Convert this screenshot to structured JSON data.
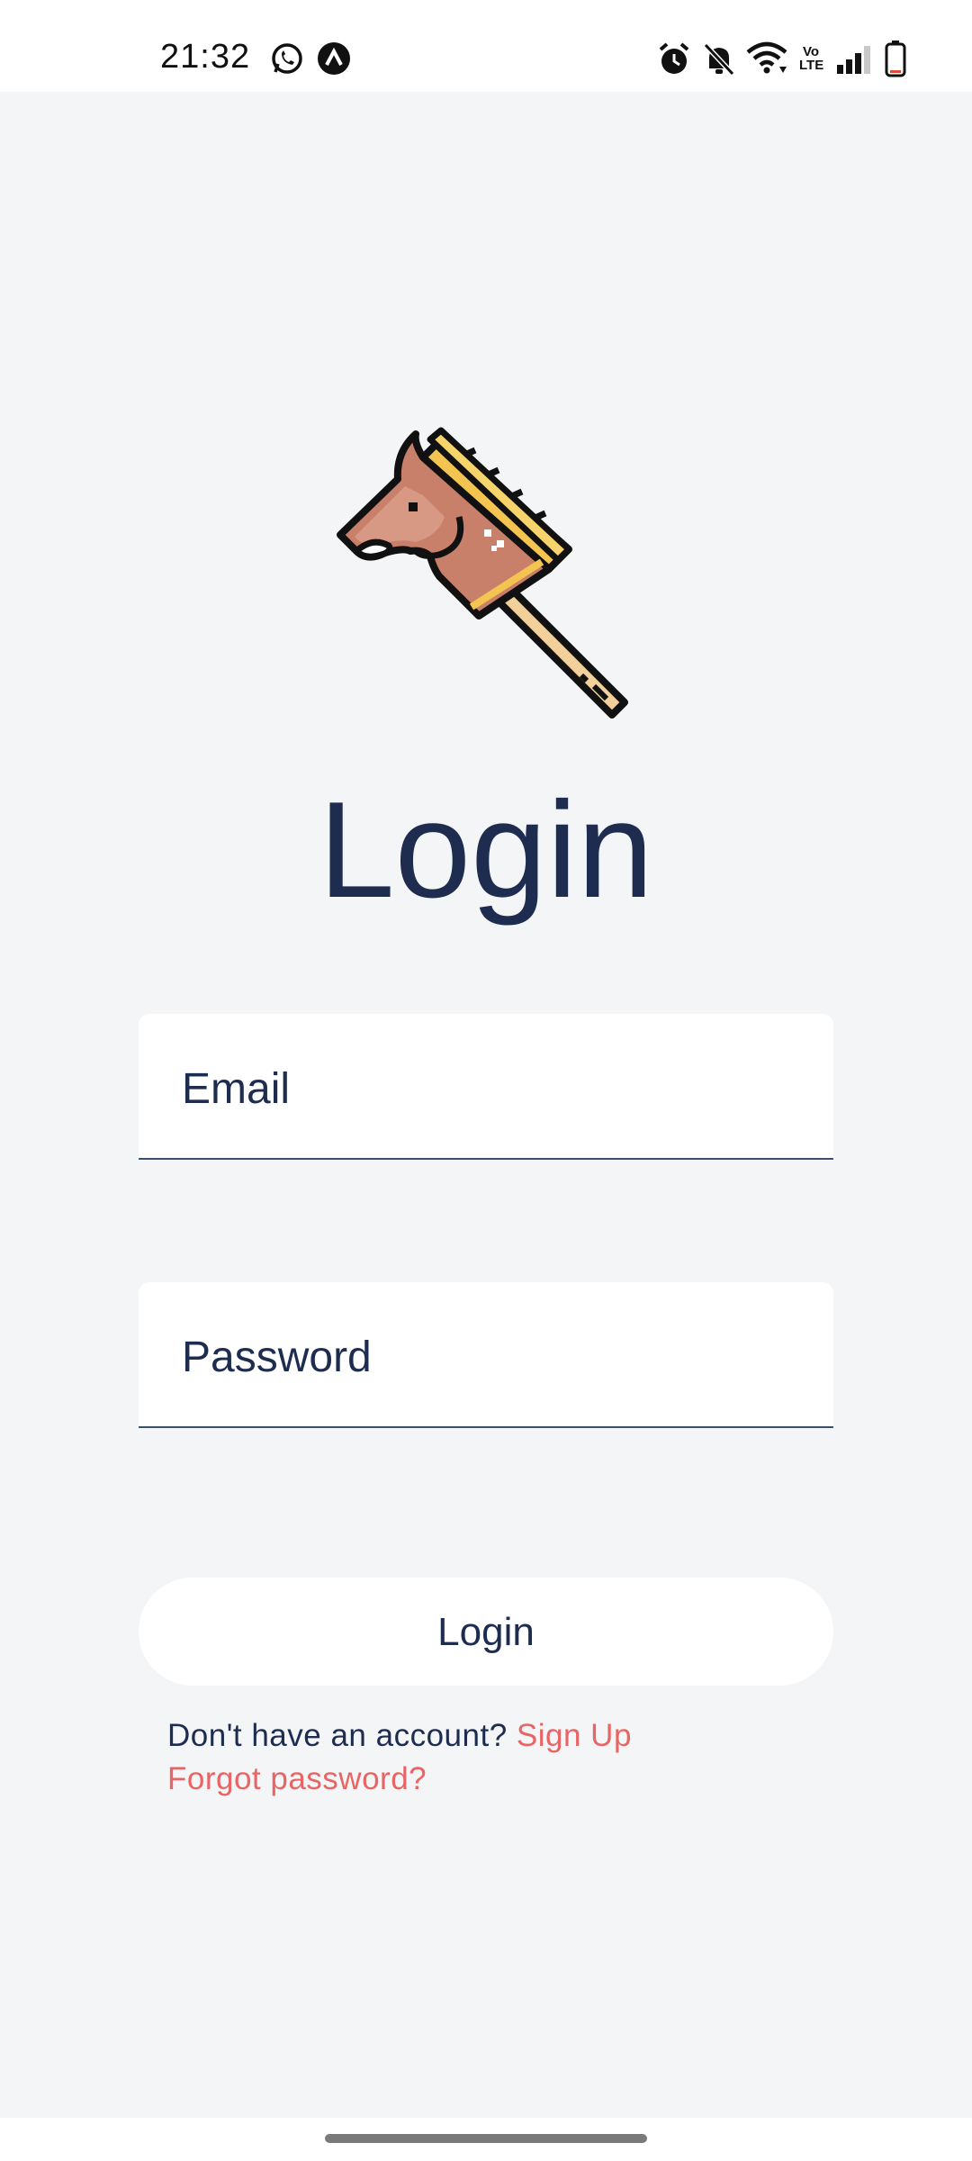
{
  "status_bar": {
    "time": "21:32",
    "left_icons": [
      "whatsapp-icon",
      "app-notification-icon"
    ],
    "right_icons": [
      "alarm-icon",
      "bell-muted-icon",
      "wifi-icon",
      "volte-icon",
      "signal-icon",
      "battery-icon"
    ],
    "volte_text": "Vo LTE"
  },
  "logo": {
    "icon": "hobby-horse-icon"
  },
  "page_title": "Login",
  "form": {
    "email_label": "Email",
    "password_label": "Password",
    "login_button_label": "Login"
  },
  "footer": {
    "no_account_text": "Don't have an account? ",
    "signup_link": "Sign Up",
    "forgot_link": "Forgot password?"
  },
  "colors": {
    "background": "#f4f5f7",
    "text_primary": "#1e2d4f",
    "link": "#e86565",
    "field_bg": "#ffffff"
  }
}
